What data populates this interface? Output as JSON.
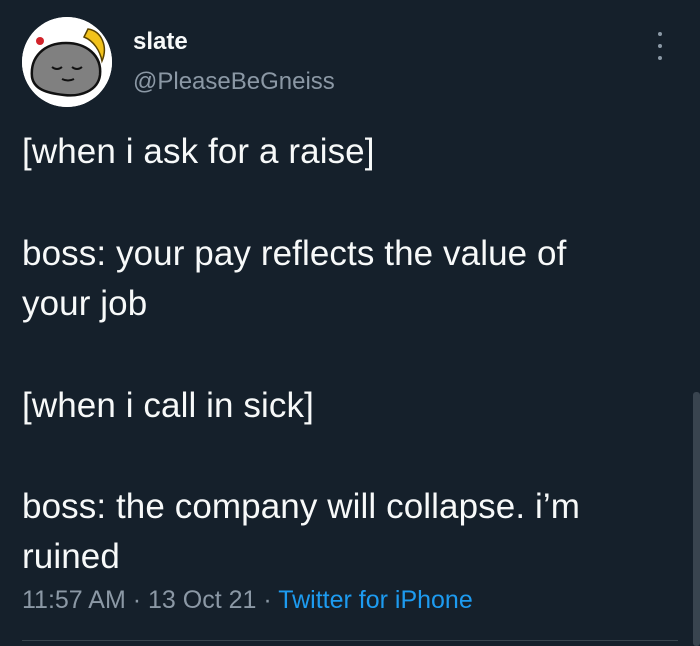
{
  "author": {
    "display_name": "slate",
    "handle": "@PleaseBeGneiss",
    "avatar_icon": "sleeping-rock-with-banana-icon",
    "more_icon": "more-options-icon"
  },
  "tweet": {
    "lines": [
      "[when i ask for a raise]",
      "boss: your pay reflects the value of",
      "your job",
      "[when i call in sick]",
      "boss: the company will collapse. i’m",
      "ruined"
    ]
  },
  "meta": {
    "time": "11:57 AM",
    "separator": "·",
    "date": "13 Oct 21",
    "source": "Twitter for iPhone"
  },
  "colors": {
    "background": "#15202b",
    "text": "#f7f9f9",
    "muted": "#8b98a5",
    "accent": "#1d9bf0"
  }
}
